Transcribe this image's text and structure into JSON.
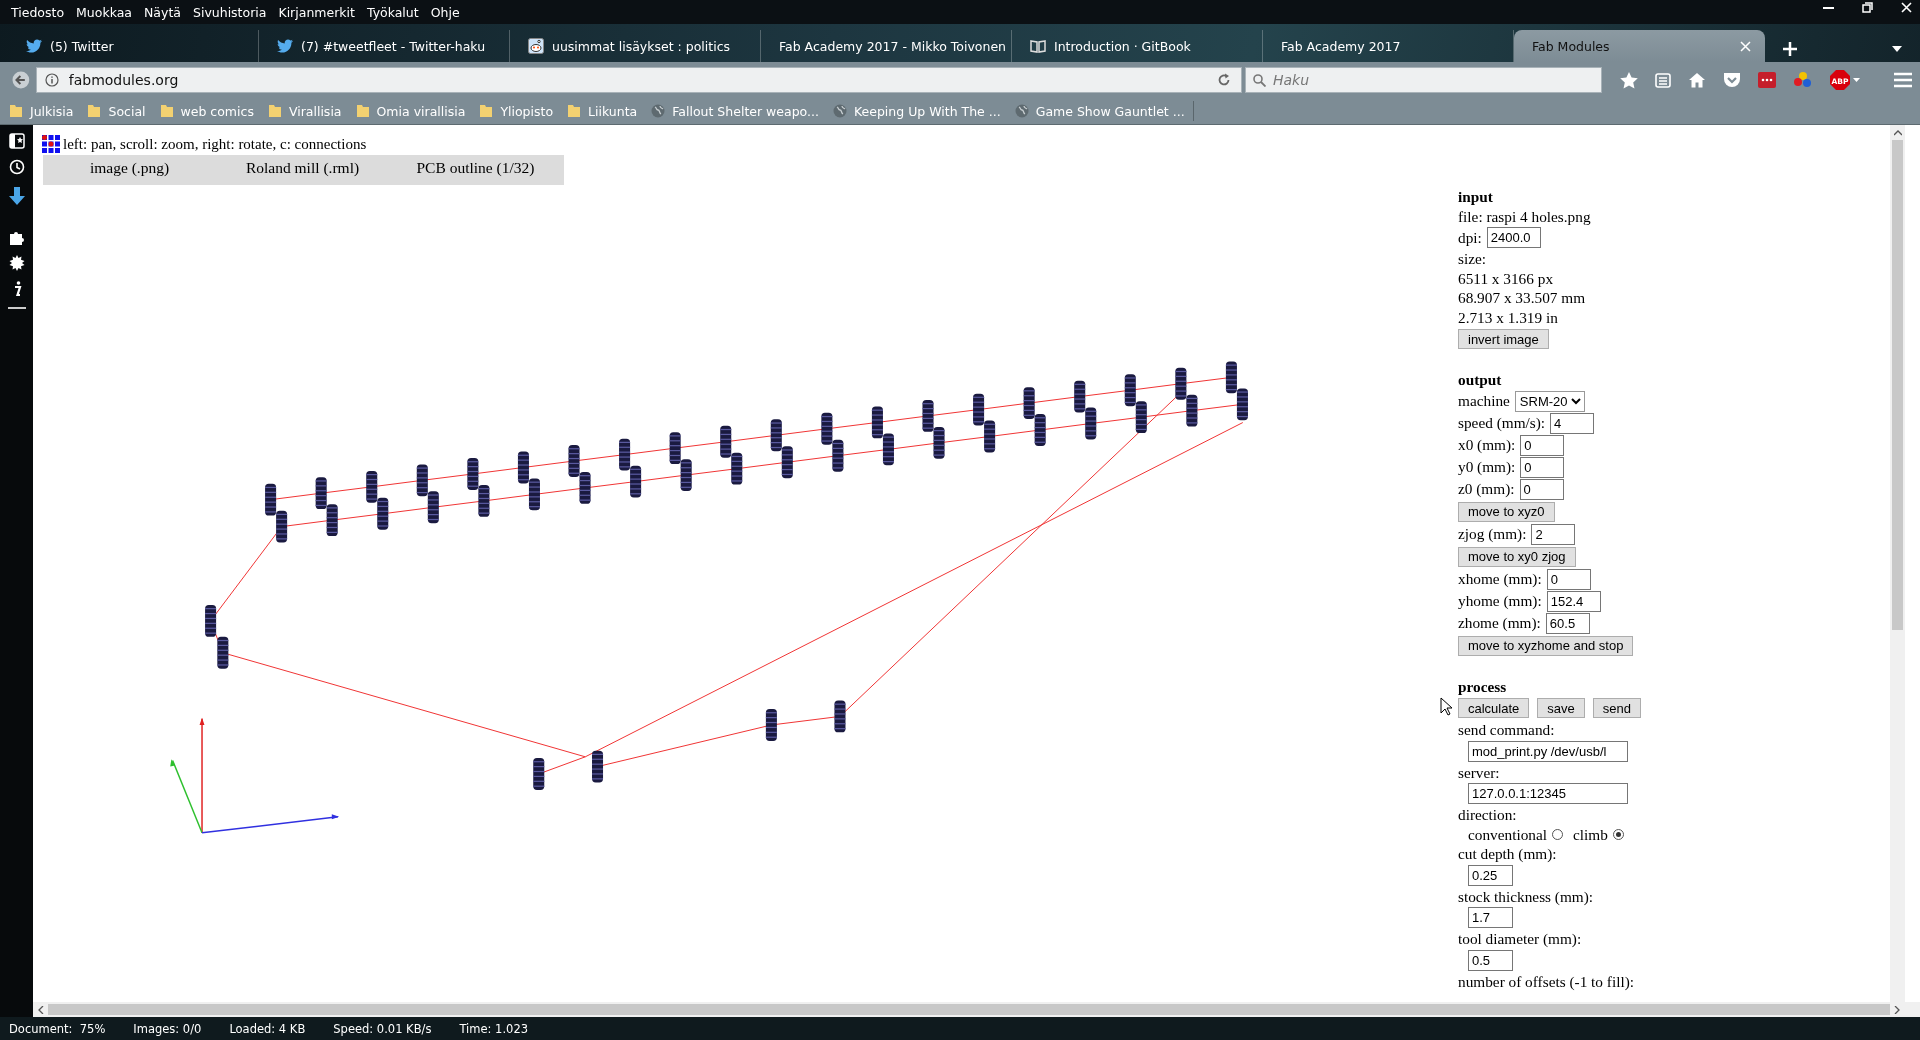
{
  "menu": [
    "Tiedosto",
    "Muokkaa",
    "Näytä",
    "Sivuhistoria",
    "Kirjanmerkit",
    "Työkalut",
    "Ohje"
  ],
  "tabs": [
    {
      "label": "(5) Twitter",
      "selected": false
    },
    {
      "label": "(7) #tweetfleet - Twitter-haku",
      "selected": false
    },
    {
      "label": "uusimmat lisäykset : politics",
      "selected": false
    },
    {
      "label": "Fab Academy 2017 - Mikko Toivonen",
      "selected": false
    },
    {
      "label": "Introduction · GitBook",
      "selected": false
    },
    {
      "label": "Fab Academy 2017",
      "selected": false
    },
    {
      "label": "Fab Modules",
      "selected": true
    }
  ],
  "adblock_badge": "ABP",
  "address_bar": {
    "url": "fabmodules.org"
  },
  "search": {
    "placeholder": "Haku"
  },
  "bookmarks": [
    {
      "label": "Julkisia",
      "kind": "folder"
    },
    {
      "label": "Social",
      "kind": "folder"
    },
    {
      "label": "web comics",
      "kind": "folder"
    },
    {
      "label": "Virallisia",
      "kind": "folder"
    },
    {
      "label": "Omia virallisia",
      "kind": "folder"
    },
    {
      "label": "Yliopisto",
      "kind": "folder"
    },
    {
      "label": "Liikunta",
      "kind": "folder"
    },
    {
      "label": "Fallout Shelter weapo...",
      "kind": "page"
    },
    {
      "label": "Keeping Up With The ...",
      "kind": "page"
    },
    {
      "label": "Game Show Gauntlet ...",
      "kind": "page"
    }
  ],
  "page": {
    "hint": "left: pan, scroll: zoom, right: rotate, c: connections",
    "toolbar": [
      "image (.png)",
      "Roland mill (.rml)",
      "PCB outline (1/32)"
    ],
    "panel": [
      {
        "kind": "heading",
        "text": "input"
      },
      {
        "kind": "text",
        "text": "file: raspi 4 holes.png"
      },
      {
        "kind": "field",
        "label": "dpi:",
        "value": "2400.0"
      },
      {
        "kind": "text",
        "text": "size:"
      },
      {
        "kind": "text",
        "text": "6511 x 3166 px"
      },
      {
        "kind": "text",
        "text": "68.907 x 33.507 mm"
      },
      {
        "kind": "text",
        "text": "2.713 x 1.319 in"
      },
      {
        "kind": "buttons",
        "buttons": [
          "invert image"
        ]
      },
      {
        "kind": "heading",
        "text": "output"
      },
      {
        "kind": "select",
        "label": "machine",
        "value": "SRM-20"
      },
      {
        "kind": "field",
        "label": "speed (mm/s):",
        "value": "4"
      },
      {
        "kind": "field",
        "label": "x0 (mm):",
        "value": "0"
      },
      {
        "kind": "field",
        "label": "y0 (mm):",
        "value": "0"
      },
      {
        "kind": "field",
        "label": "z0 (mm):",
        "value": "0"
      },
      {
        "kind": "buttons",
        "buttons": [
          "move to xyz0"
        ]
      },
      {
        "kind": "field",
        "label": "zjog (mm):",
        "value": "2"
      },
      {
        "kind": "buttons",
        "buttons": [
          "move to xy0 zjog"
        ]
      },
      {
        "kind": "field",
        "label": "xhome (mm):",
        "value": "0"
      },
      {
        "kind": "field",
        "label": "yhome (mm):",
        "value": "152.4"
      },
      {
        "kind": "field",
        "label": "zhome (mm):",
        "value": "60.5"
      },
      {
        "kind": "buttons",
        "buttons": [
          "move to xyzhome and stop"
        ]
      },
      {
        "kind": "heading",
        "text": "process"
      },
      {
        "kind": "buttons",
        "buttons": [
          "calculate",
          "save",
          "send"
        ]
      },
      {
        "kind": "text",
        "text": "send command:"
      },
      {
        "kind": "wide_field",
        "value": "mod_print.py /dev/usb/l"
      },
      {
        "kind": "text",
        "text": "server:"
      },
      {
        "kind": "wide_field",
        "value": "127.0.0.1:12345"
      },
      {
        "kind": "text",
        "text": "direction:"
      },
      {
        "kind": "radios",
        "options": [
          {
            "label": "conventional",
            "selected": false
          },
          {
            "label": "climb",
            "selected": true
          }
        ]
      },
      {
        "kind": "text",
        "text": "cut depth (mm):"
      },
      {
        "kind": "short_field",
        "value": "0.25"
      },
      {
        "kind": "text",
        "text": "stock thickness (mm):"
      },
      {
        "kind": "short_field",
        "value": "1.7"
      },
      {
        "kind": "text",
        "text": "tool diameter (mm):"
      },
      {
        "kind": "short_field",
        "value": "0.5"
      },
      {
        "kind": "text",
        "text": "number of offsets (-1 to fill):"
      }
    ]
  },
  "status_bar": [
    "Document:  75%",
    "Images: 0/0",
    "Loaded: 4 KB",
    "Speed: 0.01 KB/s",
    "Time: 1.023"
  ]
}
